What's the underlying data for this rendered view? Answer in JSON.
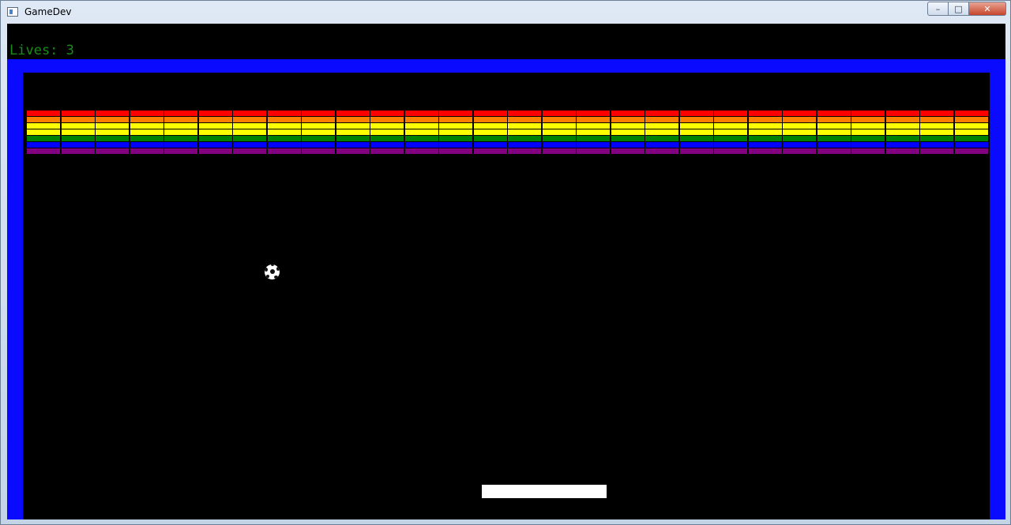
{
  "window": {
    "title": "GameDev",
    "minimize_glyph": "–",
    "maximize_glyph": "□",
    "close_glyph": "✕"
  },
  "hud": {
    "lives_label": "Lives:",
    "lives": 3
  },
  "game": {
    "brick_columns": 28,
    "brick_row_colors": [
      "#ff0000",
      "#ff8000",
      "#ffff00",
      "#ffff00",
      "#008000",
      "#0000ff",
      "#800080"
    ],
    "wall_color": "#0a0aff",
    "background_color": "#000000",
    "paddle_color": "#ffffff",
    "lives_color": "#1a8c1a"
  },
  "icons": {
    "app": "window-app-icon",
    "ball": "soccer-ball-icon"
  }
}
